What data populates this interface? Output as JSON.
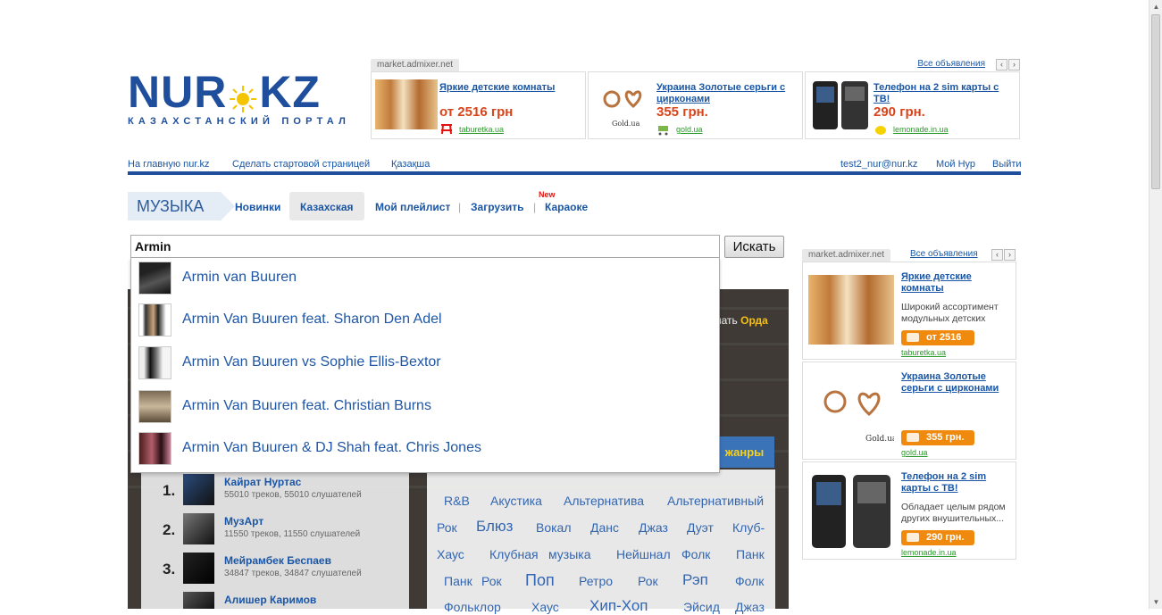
{
  "logo": {
    "brand_left": "NUR",
    "brand_right": "KZ",
    "subtitle": "КАЗАХСТАНСКИЙ ПОРТАЛ"
  },
  "top_ads": {
    "source": "market.admixer.net",
    "all_label": "Все объявления",
    "items": [
      {
        "title": "Яркие детские комнаты",
        "price": "от 2516 грн",
        "site": "taburetka.ua",
        "icon": "taburetka-logo-icon"
      },
      {
        "title": "Украина Золотые серьги с цирконами",
        "price": "355 грн.",
        "site": "gold.ua",
        "icon": "gold-cart-icon"
      },
      {
        "title": "Телефон на 2 sim карты с ТВ!",
        "price": "290 грн.",
        "site": "lemonade.in.ua",
        "icon": "lemon-icon"
      }
    ]
  },
  "top_nav": {
    "home": "На главную nur.kz",
    "startpage": "Сделать стартовой страницей",
    "kazakh": "Қазақша",
    "email": "test2_nur@nur.kz",
    "my_nur": "Мой Нур",
    "logout": "Выйти"
  },
  "music_nav": {
    "section": "МУЗЫКА",
    "items": [
      "Новинки",
      "Казахская",
      "Мой плейлист",
      "Загрузить",
      "Караоке"
    ],
    "new_badge": "New"
  },
  "search": {
    "value": "Armin",
    "button": "Искать",
    "suggestions": [
      "Armin van Buuren",
      "Armin Van Buuren feat. Sharon Den Adel",
      "Armin Van Buuren vs Sophie Ellis-Bextor",
      "Armin Van Buuren feat. Christian Burns",
      "Armin Van Buuren & DJ Shah feat. Chris Jones"
    ]
  },
  "banner": {
    "text_prefix": "шать",
    "text_highlight": "Орда"
  },
  "genres_button": "жанры",
  "artists": [
    {
      "rank": "1.",
      "name": "Кайрат Нуртас",
      "stats": "55010 треков, 55010 слушателей"
    },
    {
      "rank": "2.",
      "name": "МузАрт",
      "stats": "11550 треков, 11550 слушателей"
    },
    {
      "rank": "3.",
      "name": "Мейрамбек Беспаев",
      "stats": "34847 треков, 34847 слушателей"
    },
    {
      "rank": "",
      "name": "Алишер Каримов",
      "stats": ""
    }
  ],
  "genres": [
    "R&B",
    "Акустика",
    "Альтернатива",
    "Альтернативный",
    "Рок",
    "Блюз",
    "Вокал",
    "Данс",
    "Джаз",
    "Дуэт",
    "Клуб-",
    "Хаус",
    "Клубная",
    "музыка",
    "Нейшнал",
    "Фолк",
    "Панк",
    "Панк",
    "Рок",
    "Поп",
    "Ретро",
    "Рок",
    "Рэп",
    "Фолк",
    "Фольклор",
    "Хаус",
    "Хип-Хоп",
    "Эйсид",
    "Джаз"
  ],
  "right_ads": {
    "source": "market.admixer.net",
    "all_label": "Все объявления",
    "items": [
      {
        "title": "Яркие детские комнаты",
        "desc": "Широкий ассортимент модульных детских",
        "price": "от 2516 грн",
        "site": "taburetka.ua"
      },
      {
        "title": "Украина Золотые серьги с цирконами",
        "desc": "",
        "price": "355 грн.",
        "site": "gold.ua"
      },
      {
        "title": "Телефон на 2 sim карты с ТВ!",
        "desc": "Обладает целым рядом других внушительных...",
        "price": "290 грн.",
        "site": "lemonade.in.ua"
      }
    ]
  },
  "colors": {
    "brand_blue": "#1f4f9c",
    "link": "#1a56a5",
    "price_red": "#d9441a",
    "price_button": "#f08a0e",
    "site_green": "#2c9a2c",
    "new_red": "#e3140f"
  }
}
